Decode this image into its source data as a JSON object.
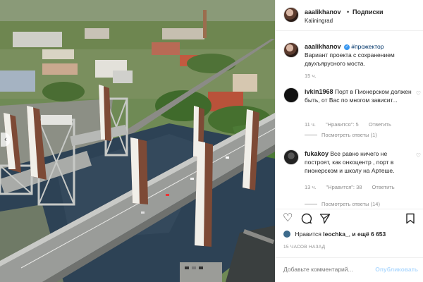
{
  "header": {
    "username": "aaalikhanov",
    "separator": "•",
    "follow_label": "Подписки",
    "location": "Kaliningrad"
  },
  "caption": {
    "username": "aaalikhanov",
    "hashtag": "#прожектор",
    "text": "Вариант проекта с сохранением двухъярусного моста.",
    "time": "15 ч."
  },
  "comments": [
    {
      "username": "ivkin1968",
      "text": "Порт в Пионерском должен быть, от Вас по многом зависит...",
      "time": "11 ч.",
      "likes": "\"Нравится\": 5",
      "reply_label": "Ответить",
      "view_replies": "Посмотреть ответы (1)"
    },
    {
      "username": "fukakoy",
      "text": "Все равно ничего не построят, как онкоцентр , порт в пионерском и школу на Артеше.",
      "time": "13 ч.",
      "likes": "\"Нравится\": 38",
      "reply_label": "Ответить",
      "view_replies": "Посмотреть ответы (14)"
    }
  ],
  "likes": {
    "prefix": "Нравится",
    "user": "leochka_",
    "suffix": "и ещё 6 653"
  },
  "timestamp": "15 ЧАСОВ НАЗАД",
  "add_comment": {
    "placeholder": "Добавьте комментарий...",
    "publish_label": "Опубликовать"
  },
  "icons": {
    "like": "heart-icon",
    "comment": "comment-icon",
    "share": "share-icon",
    "save": "bookmark-icon"
  },
  "colors": {
    "link_blue": "#003569",
    "verified_blue": "#3897f0",
    "muted": "#8e8e8e",
    "publish_disabled": "#b3dbff"
  }
}
